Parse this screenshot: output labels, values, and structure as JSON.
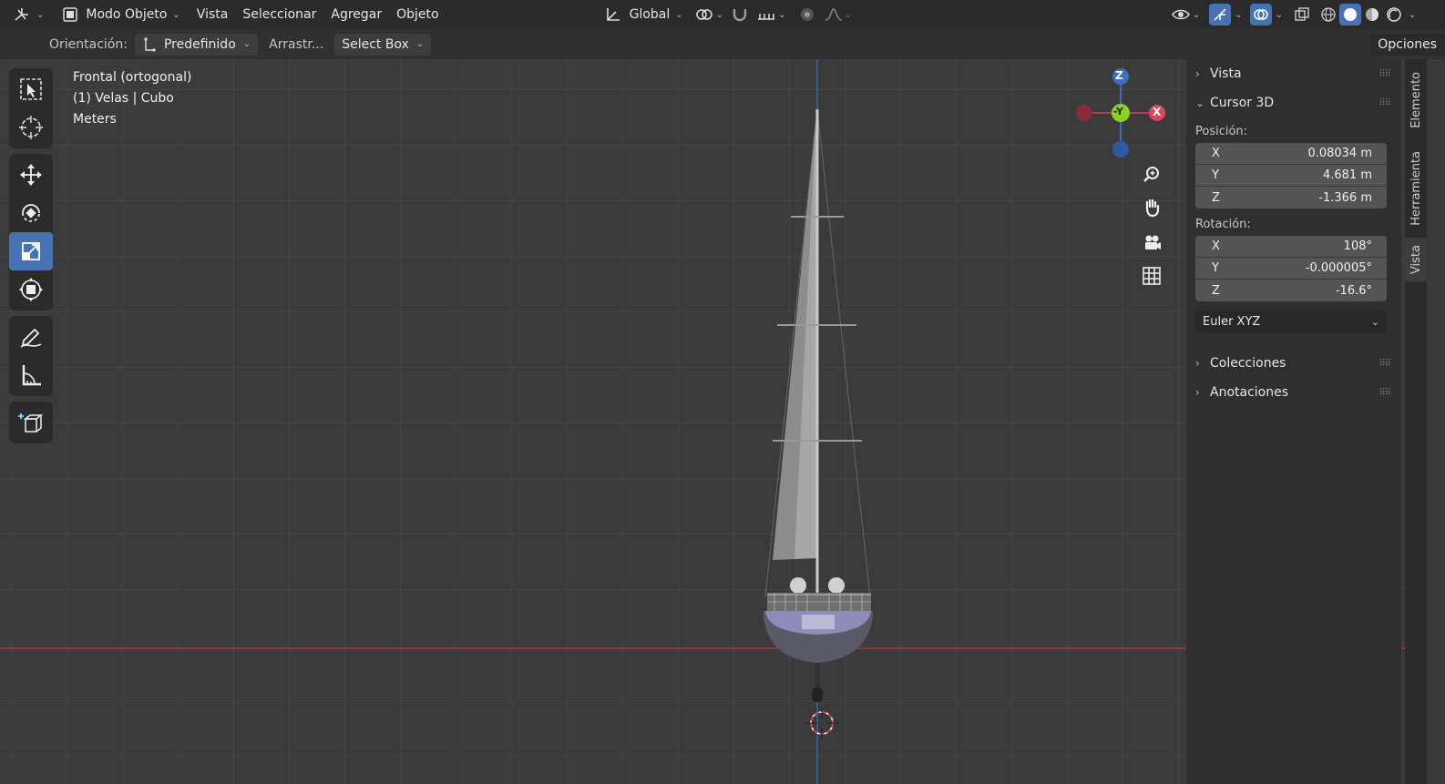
{
  "header": {
    "mode_label": "Modo Objeto",
    "menu": [
      "Vista",
      "Seleccionar",
      "Agregar",
      "Objeto"
    ],
    "transform_orientation": "Global"
  },
  "tool_settings": {
    "orientation_label": "Orientación:",
    "orientation_value": "Predefinido",
    "drag_label": "Arrastr...",
    "select_mode": "Select Box",
    "options_label": "Opciones"
  },
  "viewport": {
    "view_name": "Frontal (ortogonal)",
    "collection_info": "(1) Velas | Cubo",
    "units": "Meters",
    "gizmo": {
      "z": "Z",
      "y": "-Y",
      "x": "X"
    },
    "colors": {
      "grid_bg": "#3b3b3b",
      "x_axis": "#b83b47",
      "z_axis": "#3b6fbf",
      "y_axis": "#7ec020"
    }
  },
  "npanel": {
    "sections": {
      "vista": "Vista",
      "cursor3d": "Cursor 3D",
      "colecciones": "Colecciones",
      "anotaciones": "Anotaciones"
    },
    "position_label": "Posición:",
    "position": [
      {
        "axis": "X",
        "value": "0.08034 m"
      },
      {
        "axis": "Y",
        "value": "4.681 m"
      },
      {
        "axis": "Z",
        "value": "-1.366 m"
      }
    ],
    "rotation_label": "Rotación:",
    "rotation": [
      {
        "axis": "X",
        "value": "108°"
      },
      {
        "axis": "Y",
        "value": "-0.000005°"
      },
      {
        "axis": "Z",
        "value": "-16.6°"
      }
    ],
    "rotation_mode": "Euler XYZ"
  },
  "side_tabs": [
    "Elemento",
    "Herramienta",
    "Vista"
  ]
}
